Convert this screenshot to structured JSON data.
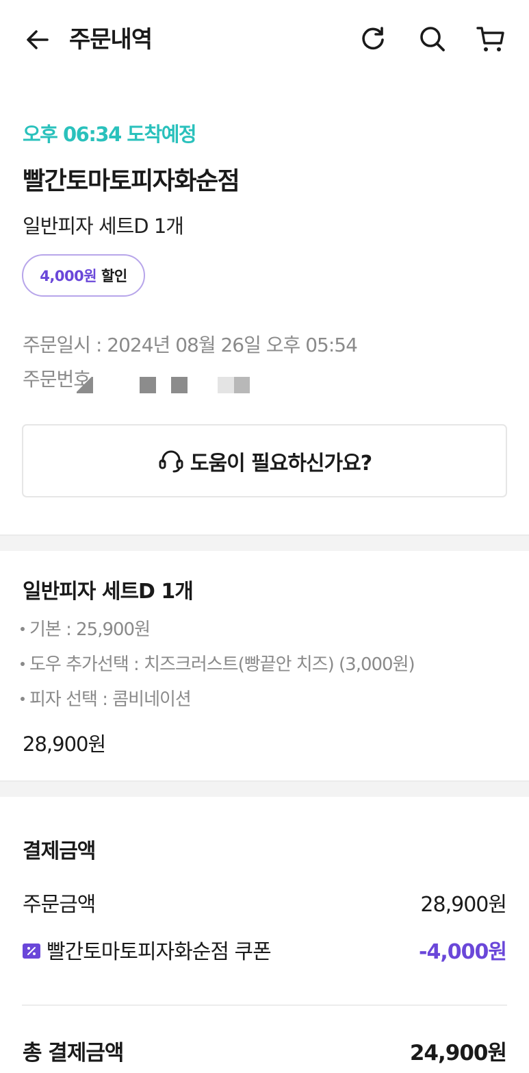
{
  "header": {
    "title": "주문내역",
    "back_icon": "arrow-left-icon",
    "icons": [
      "refresh-icon",
      "search-icon",
      "cart-icon"
    ]
  },
  "order": {
    "eta": "오후 06:34 도착예정",
    "store_name": "빨간토마토피자화순점",
    "summary": "일반피자 세트D 1개",
    "discount_amount": "4,000원",
    "discount_label": "할인",
    "date_label": "주문일시 : ",
    "date_value": "2024년 08월 26일 오후 05:54",
    "number_label": "주문번호 "
  },
  "help": {
    "label": "도움이 필요하신가요?",
    "icon": "headset-icon"
  },
  "item": {
    "name": "일반피자 세트D 1개",
    "options": [
      "기본 : 25,900원",
      "도우 추가선택 : 치즈크러스트(빵끝안 치즈) (3,000원)",
      "피자 선택 : 콤비네이션"
    ],
    "price": "28,900원"
  },
  "payment": {
    "title": "결제금액",
    "order_amount_label": "주문금액",
    "order_amount_value": "28,900원",
    "coupon_label": "빨간토마토피자화순점 쿠폰",
    "coupon_value": "-4,000원",
    "total_label": "총 결제금액",
    "total_value": "24,900원"
  },
  "colors": {
    "eta": "#2ac1bc",
    "accent": "#6a47d9",
    "badge_border": "#b7a5ea",
    "muted_text": "#8a8a8a",
    "section_band": "#f3f3f3"
  }
}
